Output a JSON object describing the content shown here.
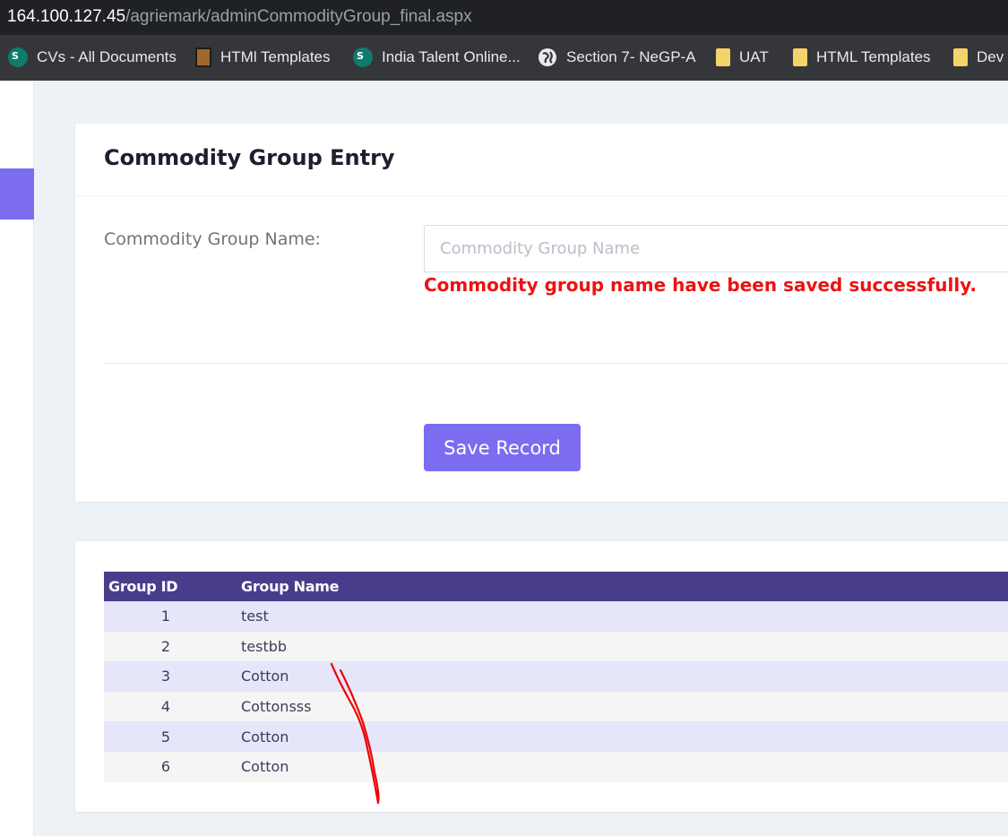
{
  "browser": {
    "url_host": "164.100.127.45",
    "url_path": "/agriemark/adminCommodityGroup_final.aspx",
    "bookmarks": [
      {
        "label": "CVs - All Documents",
        "icon": "sharepoint-icon"
      },
      {
        "label": "HTMl Templates",
        "icon": "template-icon"
      },
      {
        "label": "India Talent Online...",
        "icon": "sharepoint-icon"
      },
      {
        "label": "Section 7- NeGP-A",
        "icon": "globe-icon"
      },
      {
        "label": "UAT",
        "icon": "folder-icon"
      },
      {
        "label": "HTML Templates",
        "icon": "folder-icon"
      },
      {
        "label": "Dev",
        "icon": "folder-icon"
      }
    ]
  },
  "entry": {
    "title": "Commodity Group Entry",
    "field_label": "Commodity Group Name:",
    "input_placeholder": "Commodity Group Name",
    "input_value": "",
    "success_message": "Commodity group name have been saved successfully.",
    "save_label": "Save Record"
  },
  "table": {
    "columns": [
      "Group ID",
      "Group Name"
    ],
    "rows": [
      {
        "id": "1",
        "name": "test"
      },
      {
        "id": "2",
        "name": "testbb"
      },
      {
        "id": "3",
        "name": "Cotton"
      },
      {
        "id": "4",
        "name": "Cottonsss"
      },
      {
        "id": "5",
        "name": "Cotton"
      },
      {
        "id": "6",
        "name": "Cotton"
      }
    ]
  },
  "colors": {
    "accent": "#7c6cf0",
    "table_header": "#483d8b",
    "success_text": "#ee1111",
    "row_odd": "#e6e6fa",
    "row_even": "#f5f5f5",
    "annotation": "#ee0000"
  }
}
